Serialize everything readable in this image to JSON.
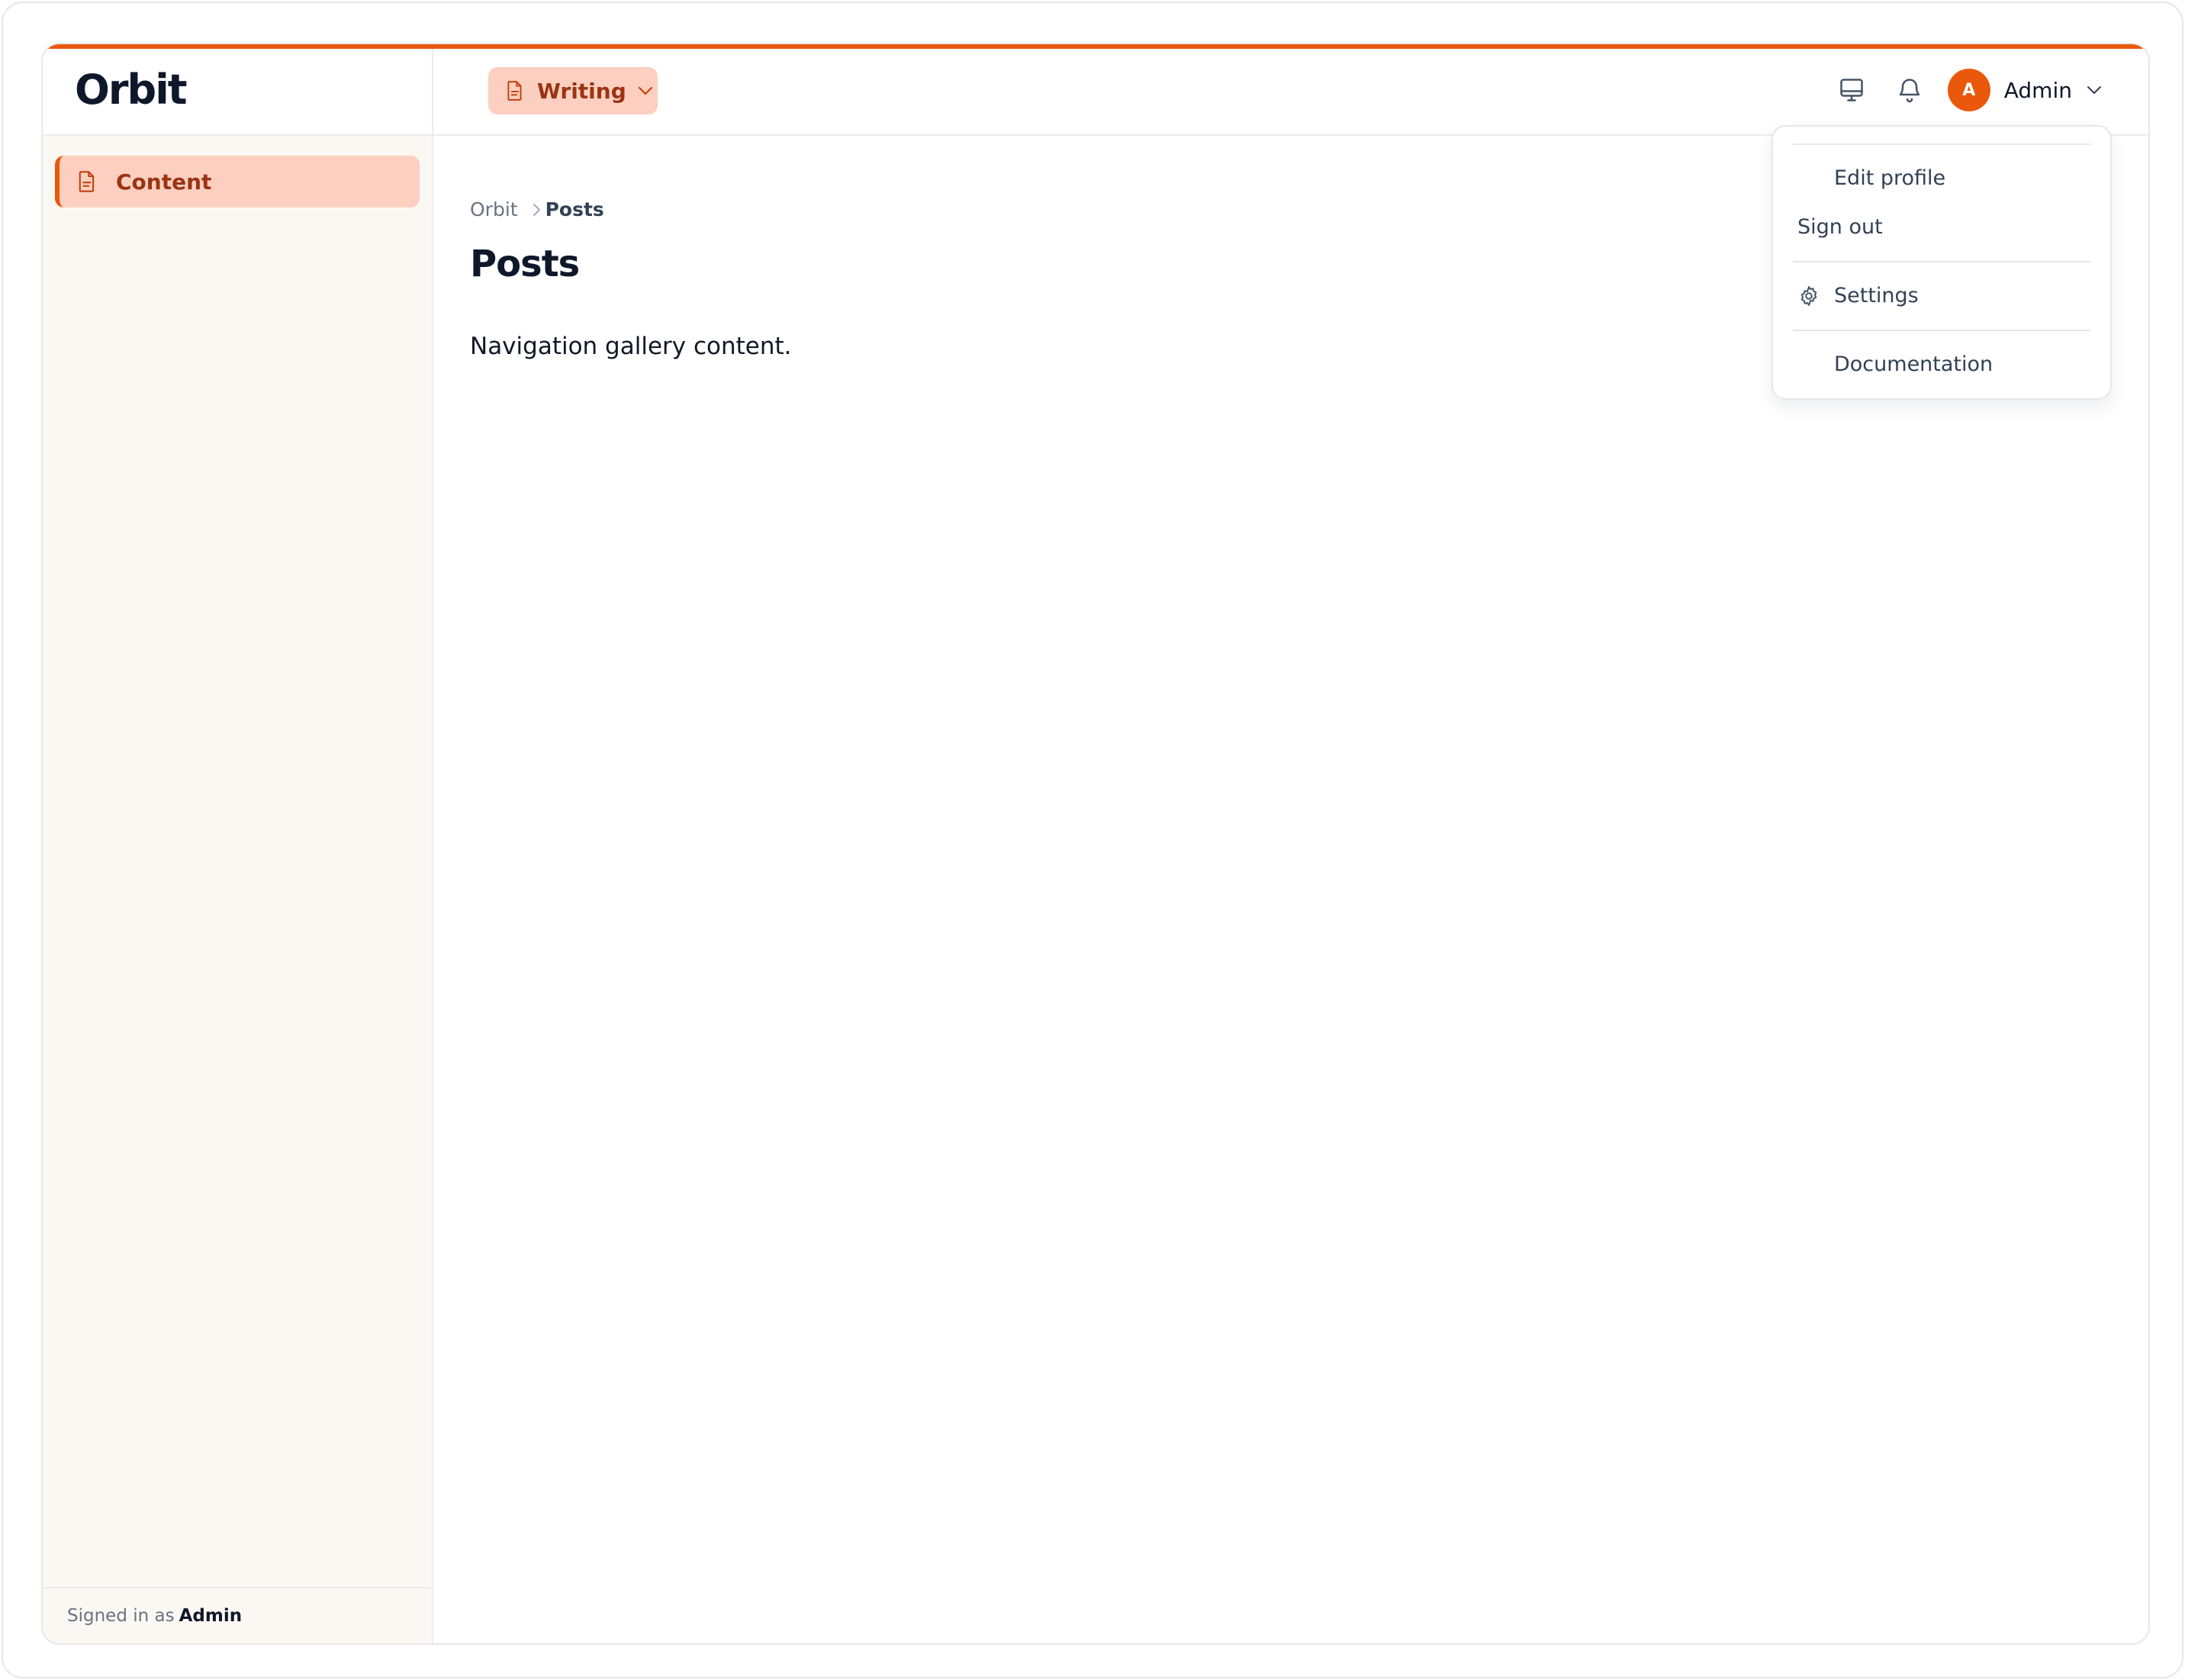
{
  "brand": {
    "name": "Orbit"
  },
  "sidebar": {
    "items": [
      {
        "label": "Content",
        "icon": "document-icon",
        "active": true
      }
    ],
    "footer": {
      "prefix": "Signed in as",
      "user": "Admin"
    }
  },
  "header": {
    "workspace": {
      "label": "Writing",
      "icon": "document-icon"
    },
    "icons": [
      "monitor-icon",
      "bell-icon"
    ],
    "user": {
      "initial": "A",
      "name": "Admin"
    }
  },
  "breadcrumb": {
    "root": "Orbit",
    "current": "Posts"
  },
  "page": {
    "title": "Posts",
    "body": "Navigation gallery content."
  },
  "user_menu": {
    "items": [
      {
        "label": "Edit profile"
      },
      {
        "label": "Sign out"
      },
      {
        "label": "Settings",
        "icon": "gear-icon"
      },
      {
        "label": "Documentation"
      }
    ]
  },
  "colors": {
    "accent": "#ea580c",
    "accent_soft": "#fdcfc0",
    "accent_text": "#9a3412"
  }
}
